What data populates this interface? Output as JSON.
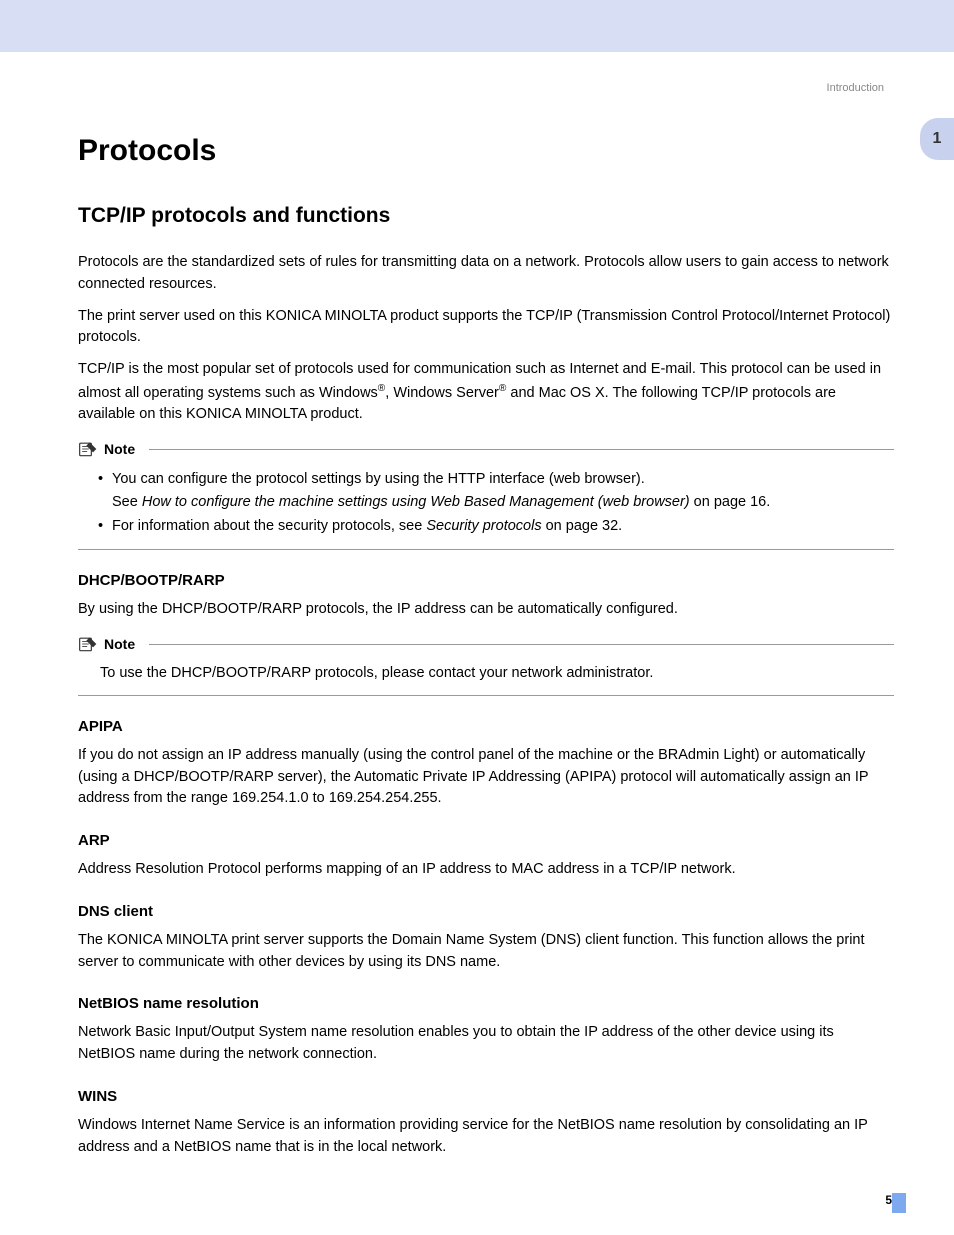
{
  "header": {
    "breadcrumb": "Introduction"
  },
  "chapter_tab": "1",
  "title": "Protocols",
  "section_heading": "TCP/IP protocols and functions",
  "intro_paragraphs": {
    "p1": "Protocols are the standardized sets of rules for transmitting data on a network. Protocols allow users to gain access to network connected resources.",
    "p2": "The print server used on this KONICA MINOLTA product supports the TCP/IP (Transmission Control Protocol/Internet Protocol) protocols.",
    "p3_prefix": "TCP/IP is the most popular set of protocols used for communication such as Internet and E-mail. This protocol can be used in almost all operating systems such as Windows",
    "p3_mid": ", Windows Server",
    "p3_suffix": " and Mac OS X. The following TCP/IP protocols are available on this KONICA MINOLTA product."
  },
  "note_label": "Note",
  "note1": {
    "bullet1_line1": "You can configure the protocol settings by using the HTTP interface (web browser).",
    "bullet1_line2_prefix": "See ",
    "bullet1_line2_italic": "How to configure the machine settings using Web Based Management (web browser)",
    "bullet1_line2_suffix": " on page 16.",
    "bullet2_prefix": "For information about the security protocols, see ",
    "bullet2_italic": "Security protocols",
    "bullet2_suffix": " on page 32."
  },
  "sections": {
    "dhcp": {
      "heading": "DHCP/BOOTP/RARP",
      "body": "By using the DHCP/BOOTP/RARP protocols, the IP address can be automatically configured.",
      "note": "To use the DHCP/BOOTP/RARP protocols, please contact your network administrator."
    },
    "apipa": {
      "heading": "APIPA",
      "body": "If you do not assign an IP address manually (using the control panel of the machine or the BRAdmin Light) or automatically (using a DHCP/BOOTP/RARP server), the Automatic Private IP Addressing (APIPA) protocol will automatically assign an IP address from the range 169.254.1.0 to 169.254.254.255."
    },
    "arp": {
      "heading": "ARP",
      "body": "Address Resolution Protocol performs mapping of an IP address to MAC address in a TCP/IP network."
    },
    "dns": {
      "heading": "DNS client",
      "body": "The KONICA MINOLTA print server supports the Domain Name System (DNS) client function. This function allows the print server to communicate with other devices by using its DNS name."
    },
    "netbios": {
      "heading": "NetBIOS name resolution",
      "body": "Network Basic Input/Output System name resolution enables you to obtain the IP address of the other device using its NetBIOS name during the network connection."
    },
    "wins": {
      "heading": "WINS",
      "body": "Windows Internet Name Service is an information providing service for the NetBIOS name resolution by consolidating an IP address and a NetBIOS name that is in the local network."
    }
  },
  "page_number": "5"
}
